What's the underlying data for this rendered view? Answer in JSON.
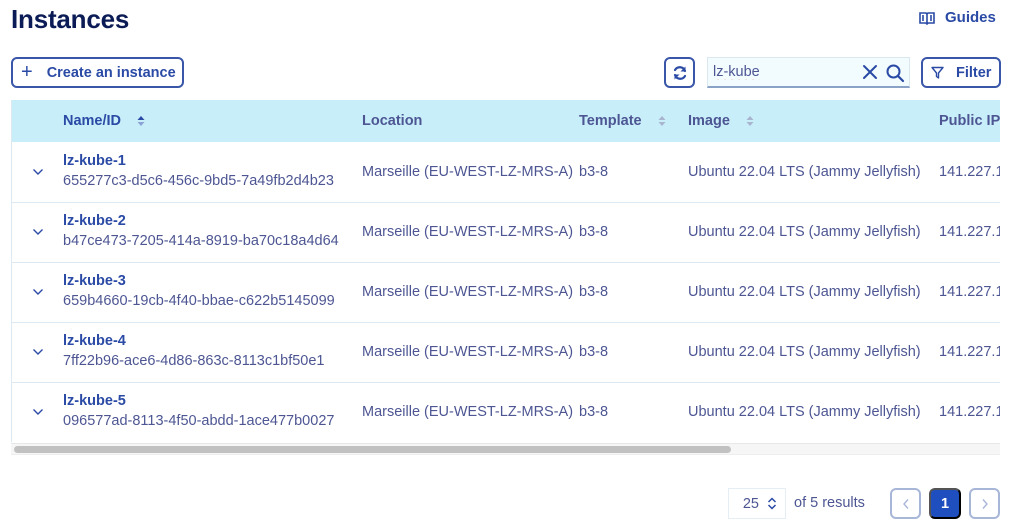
{
  "header": {
    "title": "Instances",
    "guides_label": "Guides",
    "guides_icon": "book-icon"
  },
  "toolbar": {
    "create_label": "Create an instance",
    "create_icon": "plus-icon",
    "refresh_icon": "refresh-icon",
    "search": {
      "value": "lz-kube",
      "placeholder": "",
      "clear_icon": "close-icon",
      "search_icon": "search-icon"
    },
    "filter_label": "Filter",
    "filter_icon": "funnel-icon"
  },
  "table": {
    "columns": [
      {
        "label": "",
        "sortable": false
      },
      {
        "label": "Name/ID",
        "sortable": true
      },
      {
        "label": "Location",
        "sortable": false
      },
      {
        "label": "Template",
        "sortable": true
      },
      {
        "label": "Image",
        "sortable": true
      },
      {
        "label": "Public IP",
        "sortable": false
      }
    ],
    "rows": [
      {
        "name": "lz-kube-1",
        "id": "655277c3-d5c6-456c-9bd5-7a49fb2d4b23",
        "location": "Marseille (EU-WEST-LZ-MRS-A)",
        "template": "b3-8",
        "image": "Ubuntu 22.04 LTS (Jammy Jellyfish)",
        "public_ip": "141.227.1"
      },
      {
        "name": "lz-kube-2",
        "id": "b47ce473-7205-414a-8919-ba70c18a4d64",
        "location": "Marseille (EU-WEST-LZ-MRS-A)",
        "template": "b3-8",
        "image": "Ubuntu 22.04 LTS (Jammy Jellyfish)",
        "public_ip": "141.227.1"
      },
      {
        "name": "lz-kube-3",
        "id": "659b4660-19cb-4f40-bbae-c622b5145099",
        "location": "Marseille (EU-WEST-LZ-MRS-A)",
        "template": "b3-8",
        "image": "Ubuntu 22.04 LTS (Jammy Jellyfish)",
        "public_ip": "141.227.1"
      },
      {
        "name": "lz-kube-4",
        "id": "7ff22b96-ace6-4d86-863c-8113c1bf50e1",
        "location": "Marseille (EU-WEST-LZ-MRS-A)",
        "template": "b3-8",
        "image": "Ubuntu 22.04 LTS (Jammy Jellyfish)",
        "public_ip": "141.227.1"
      },
      {
        "name": "lz-kube-5",
        "id": "096577ad-8113-4f50-abdd-1ace477b0027",
        "location": "Marseille (EU-WEST-LZ-MRS-A)",
        "template": "b3-8",
        "image": "Ubuntu 22.04 LTS (Jammy Jellyfish)",
        "public_ip": "141.227.1"
      }
    ]
  },
  "pagination": {
    "page_size": "25",
    "results_text": "of 5 results",
    "current_page": "1",
    "prev_icon": "chevron-left-icon",
    "next_icon": "chevron-right-icon"
  },
  "colors": {
    "primary": "#2a4aa5",
    "title": "#0b1b55",
    "header_bg": "#c8eefa",
    "text": "#4d5693",
    "active_page": "#1f4fbf"
  }
}
